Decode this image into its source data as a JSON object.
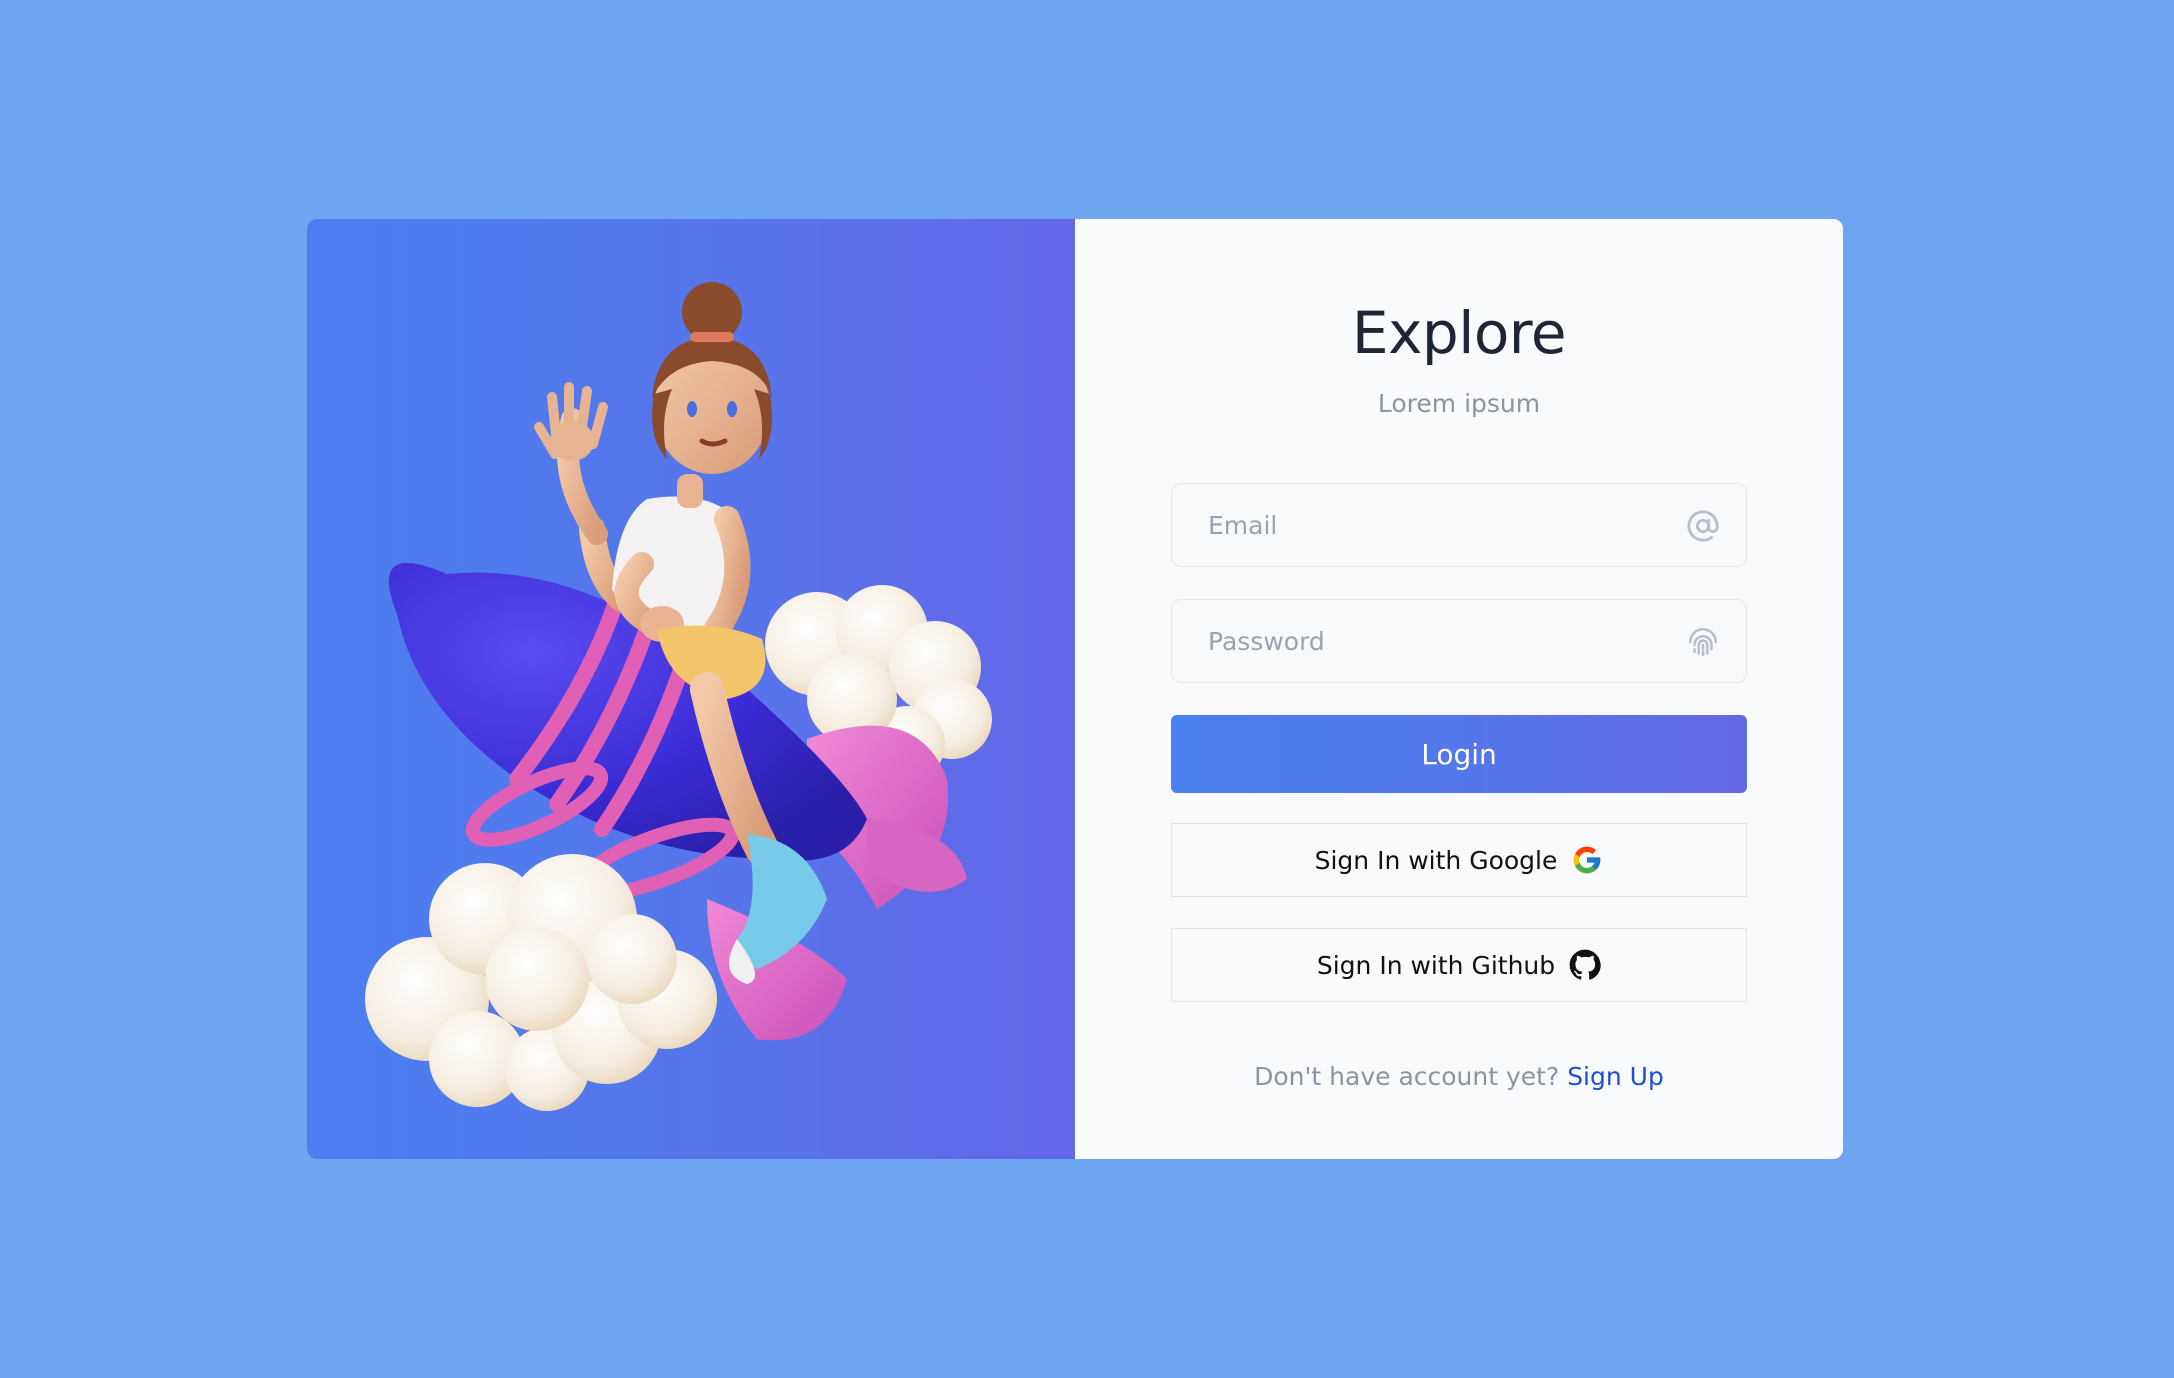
{
  "form": {
    "title": "Explore",
    "subtitle": "Lorem ipsum",
    "email_placeholder": "Email",
    "email_icon": "at-sign-icon",
    "password_placeholder": "Password",
    "password_icon": "fingerprint-icon",
    "login_label": "Login",
    "google_label": "Sign In with Google",
    "google_icon": "google-icon",
    "github_label": "Sign In with Github",
    "github_icon": "github-icon",
    "signup_prompt": "Don't have account yet?",
    "signup_link": "Sign Up"
  },
  "colors": {
    "page_background": "#6ea5f1",
    "panel_gradient_start": "#4a7ff0",
    "panel_gradient_end": "#6467e8",
    "login_button": "#5477ea",
    "link": "#1f4fd1"
  }
}
